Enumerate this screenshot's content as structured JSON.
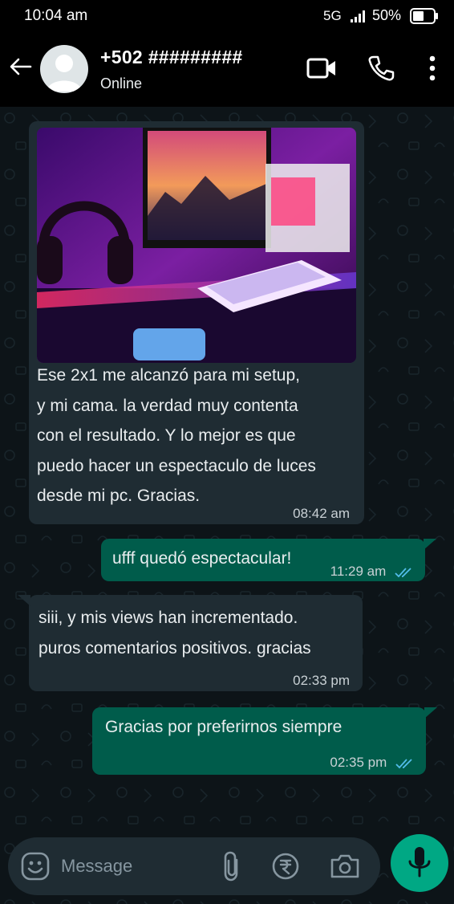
{
  "status_bar": {
    "time": "10:04 am",
    "network": "5G",
    "battery": "50%"
  },
  "header": {
    "contact_name": "+502 #########",
    "status": "Online",
    "icons": [
      "back-arrow-icon",
      "avatar",
      "video-call-icon",
      "phone-icon",
      "more-vert-icon"
    ]
  },
  "messages": [
    {
      "direction": "incoming",
      "has_image": true,
      "lines": [
        "Ese 2x1 me alcanzó para mi setup,",
        "y mi cama. la verdad muy contenta",
        "con el resultado. Y lo mejor es que",
        "puedo hacer un espectaculo de luces",
        "desde mi pc. Gracias."
      ],
      "time": "08:42 am"
    },
    {
      "direction": "outgoing",
      "lines": [
        "ufff quedó espectacular!"
      ],
      "time": "11:29 am",
      "read": true
    },
    {
      "direction": "incoming",
      "lines": [
        "siii, y mis views han incrementado.",
        "puros comentarios positivos. gracias"
      ],
      "time": "02:33 pm"
    },
    {
      "direction": "outgoing",
      "lines": [
        "Gracias por preferirnos siempre"
      ],
      "time": "02:35 pm",
      "read": true
    }
  ],
  "composer": {
    "placeholder": "Message",
    "icons": [
      "emoji-icon",
      "attach-icon",
      "rupee-payment-icon",
      "camera-icon",
      "mic-icon"
    ]
  },
  "colors": {
    "incoming_bubble": "#1f2c33",
    "outgoing_bubble": "#005c4b",
    "accent": "#00a884",
    "read_ticks": "#53bdeb"
  }
}
